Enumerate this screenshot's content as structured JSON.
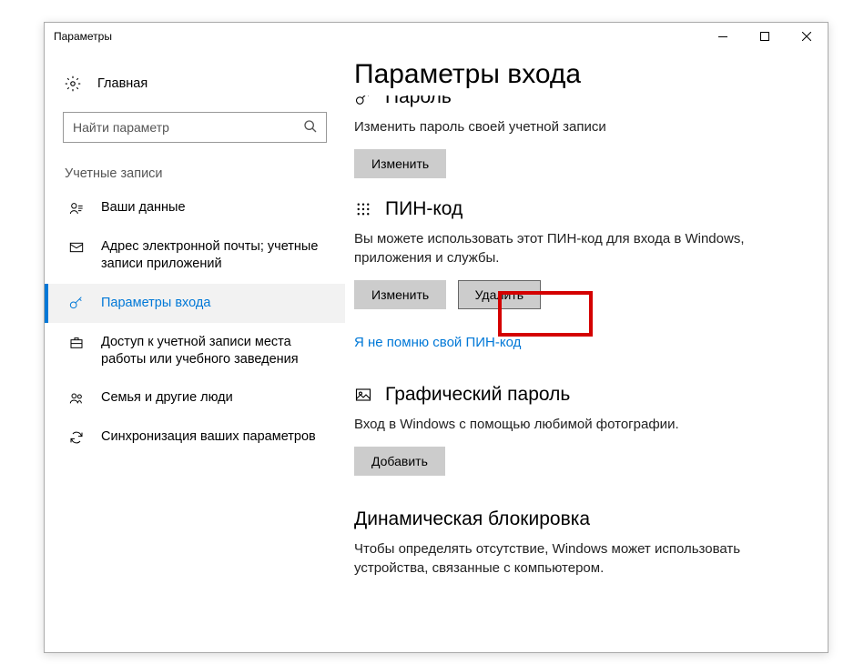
{
  "window": {
    "title": "Параметры"
  },
  "sidebar": {
    "home": "Главная",
    "search_placeholder": "Найти параметр",
    "category": "Учетные записи",
    "items": [
      {
        "label": "Ваши данные"
      },
      {
        "label": "Адрес электронной почты; учетные записи приложений"
      },
      {
        "label": "Параметры входа"
      },
      {
        "label": "Доступ к учетной записи места работы или учебного заведения"
      },
      {
        "label": "Семья и другие люди"
      },
      {
        "label": "Синхронизация ваших параметров"
      }
    ]
  },
  "main": {
    "title": "Параметры входа",
    "password": {
      "heading": "Пароль",
      "desc": "Изменить пароль своей учетной записи",
      "change_btn": "Изменить"
    },
    "pin": {
      "heading": "ПИН-код",
      "desc": "Вы можете использовать этот ПИН-код для входа в Windows, приложения и службы.",
      "change_btn": "Изменить",
      "remove_btn": "Удалить",
      "forgot_link": "Я не помню свой ПИН-код"
    },
    "picture": {
      "heading": "Графический пароль",
      "desc": "Вход в Windows с помощью любимой фотографии.",
      "add_btn": "Добавить"
    },
    "dynamic": {
      "heading": "Динамическая блокировка",
      "desc": "Чтобы определять отсутствие, Windows может использовать устройства, связанные с компьютером."
    }
  }
}
